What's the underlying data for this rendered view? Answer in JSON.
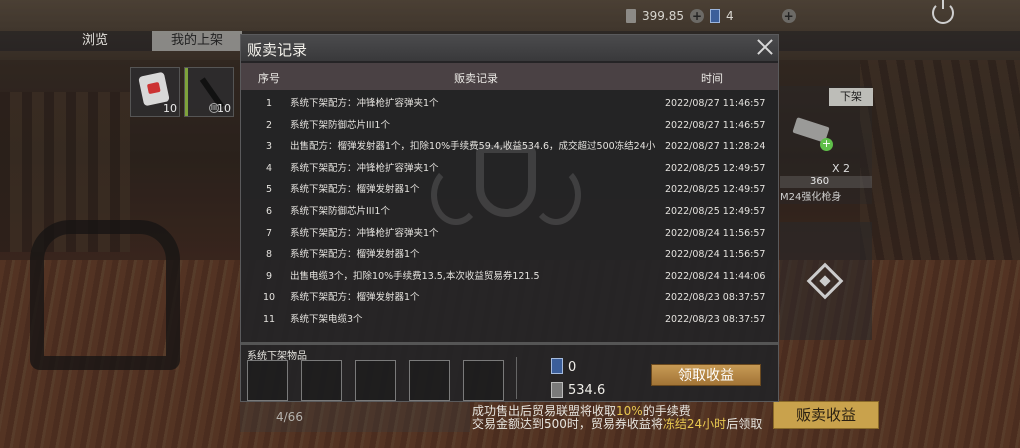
{
  "hud": {
    "balance": "399.85",
    "tickets": "4"
  },
  "tabs": {
    "browse": "浏览",
    "my_listings": "我的上架"
  },
  "inventory": [
    {
      "count": "10"
    },
    {
      "count": "10"
    }
  ],
  "side": {
    "delist_label": "下架",
    "multiplier": "X 2",
    "price": "360",
    "item_name": "M24强化枪身"
  },
  "modal": {
    "title": "贩卖记录",
    "columns": {
      "no": "序号",
      "record": "贩卖记录",
      "time": "时间"
    },
    "rows": [
      {
        "no": "1",
        "record": "系统下架配方：冲锋枪扩容弹夹1个",
        "time": "2022/08/27 11:46:57"
      },
      {
        "no": "2",
        "record": "系统下架防御芯片III1个",
        "time": "2022/08/27 11:46:57"
      },
      {
        "no": "3",
        "record": "出售配方：榴弹发射器1个，扣除10%手续费59.4,收益534.6，成交超过500冻结24小",
        "time": "2022/08/27 11:28:24"
      },
      {
        "no": "4",
        "record": "系统下架配方：冲锋枪扩容弹夹1个",
        "time": "2022/08/25 12:49:57"
      },
      {
        "no": "5",
        "record": "系统下架配方：榴弹发射器1个",
        "time": "2022/08/25 12:49:57"
      },
      {
        "no": "6",
        "record": "系统下架防御芯片III1个",
        "time": "2022/08/25 12:49:57"
      },
      {
        "no": "7",
        "record": "系统下架配方：冲锋枪扩容弹夹1个",
        "time": "2022/08/24 11:56:57"
      },
      {
        "no": "8",
        "record": "系统下架配方：榴弹发射器1个",
        "time": "2022/08/24 11:56:57"
      },
      {
        "no": "9",
        "record": "出售电缆3个，扣除10%手续费13.5,本次收益贸易券121.5",
        "time": "2022/08/24 11:44:06"
      },
      {
        "no": "10",
        "record": "系统下架配方：榴弹发射器1个",
        "time": "2022/08/23 08:37:57"
      },
      {
        "no": "11",
        "record": "系统下架电缆3个",
        "time": "2022/08/23 08:37:57"
      }
    ],
    "delisted_label": "系统下架物品",
    "ticket_amount": "0",
    "earnings_amount": "534.6",
    "claim_button": "领取收益"
  },
  "footer": {
    "page_count": "4/66",
    "fee_line1_a": "成功售出后贸易联盟将收取",
    "fee_line1_hl": "10%",
    "fee_line1_b": "的手续费",
    "fee_line2_a": "交易金额达到500时，贸易券收益将",
    "fee_line2_hl": "冻结24小时",
    "fee_line2_b": "后领取",
    "sell_record_button": "贩卖收益"
  },
  "colors": {
    "accent_gold": "#c9a24c",
    "highlight_yellow": "#e8c850",
    "modal_bg": "#242426"
  }
}
